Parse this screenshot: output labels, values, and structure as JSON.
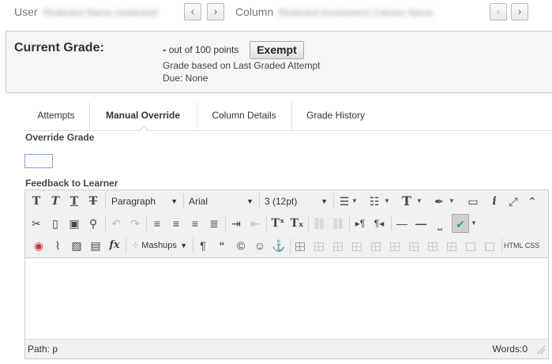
{
  "topbar": {
    "user_label": "User",
    "user_value": "Redacted Name (redacted)",
    "column_label": "Column",
    "column_value": "Redacted Assignment Column Name",
    "prev": "‹",
    "next": "›"
  },
  "grade": {
    "label": "Current Grade:",
    "score": "-",
    "out_of": "out of 100 points",
    "exempt_button": "Exempt",
    "based_on": "Grade based on Last Graded Attempt",
    "due": "Due: None"
  },
  "tabs": [
    {
      "label": "Attempts",
      "active": false
    },
    {
      "label": "Manual Override",
      "active": true
    },
    {
      "label": "Column Details",
      "active": false
    },
    {
      "label": "Grade History",
      "active": false
    }
  ],
  "override": {
    "label": "Override Grade",
    "value": ""
  },
  "feedback": {
    "label": "Feedback to Learner"
  },
  "editor": {
    "format_select": "Paragraph",
    "font_select": "Arial",
    "size_select": "3 (12pt)",
    "mashups": "Mashups",
    "html_btn": "HTML",
    "css_btn": "CSS",
    "path_label": "Path: p",
    "words_label": "Words:0"
  }
}
